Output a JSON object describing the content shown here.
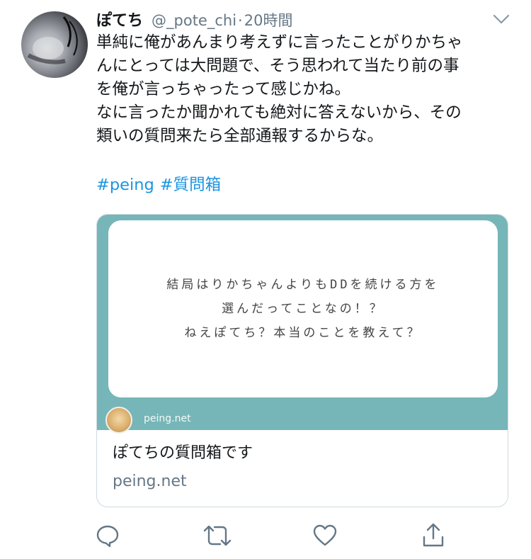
{
  "user": {
    "name": "ぽてち",
    "handle": "@_pote_chi",
    "separator": "·",
    "time": "20時間"
  },
  "tweet": {
    "lines": [
      "単純に俺があんまり考えずに言ったことがりかちゃ",
      "んにとっては大問題で、そう思われて当たり前の事",
      "を俺が言っちゃったって感じかね。",
      "なに言ったか聞かれても絶対に答えないから、その",
      "類いの質問来たら全部通報するからな。"
    ],
    "hashtags": [
      "#peing",
      "#質問箱"
    ]
  },
  "card": {
    "question_lines": [
      "結局はりかちゃんよりもDDを続ける方を",
      "選んだってことなの！？",
      "ねえぽてち？本当のことを教えて？"
    ],
    "image_domain": "peing.net",
    "title": "ぽてちの質問箱です",
    "domain": "peing.net"
  },
  "icons": {
    "chevron": "chevron-down-icon",
    "reply": "reply-icon",
    "retweet": "retweet-icon",
    "like": "heart-icon",
    "share": "share-icon"
  },
  "colors": {
    "link": "#1b95e0",
    "muted": "#657786",
    "card_teal": "#76b6b8"
  }
}
